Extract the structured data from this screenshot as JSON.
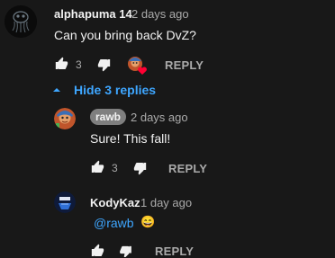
{
  "comment": {
    "author": "alphapuma 14",
    "time": "2 days ago",
    "text": "Can you bring back DvZ?",
    "likes": "3",
    "reply_label": "REPLY"
  },
  "replies_toggle": {
    "label": "Hide 3 replies"
  },
  "replies": [
    {
      "author": "rawb",
      "time": "2 days ago",
      "text": "Sure! This fall!",
      "likes": "3",
      "reply_label": "REPLY"
    },
    {
      "author": "KodyKaz",
      "time": "1 day ago",
      "mention": "@rawb",
      "emoji": "😄",
      "reply_label": "REPLY"
    }
  ],
  "colors": {
    "background": "#181818",
    "link": "#3ea6ff",
    "secondary_text": "#aaaaaa",
    "creator_heart": "#ff0033"
  }
}
